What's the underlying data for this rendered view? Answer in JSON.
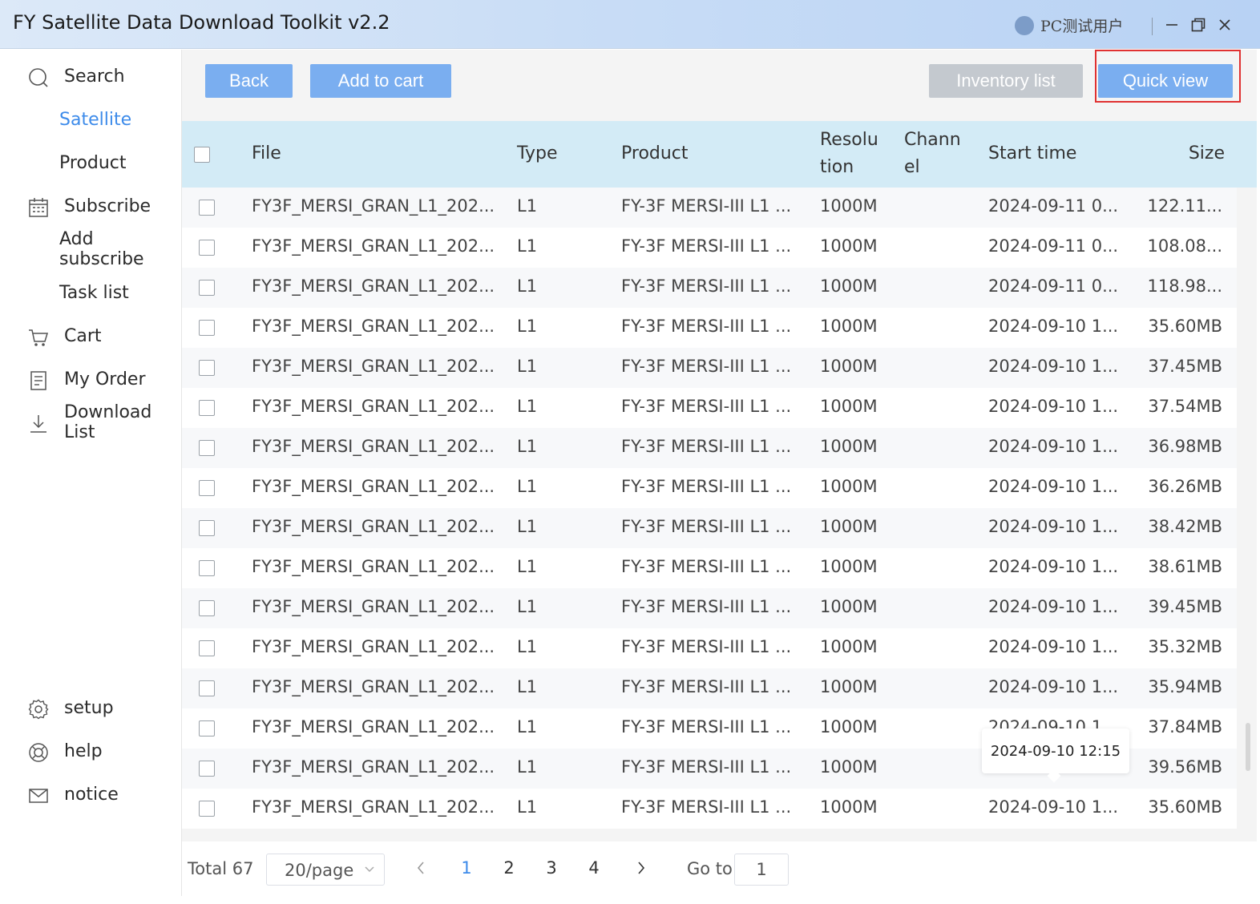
{
  "window": {
    "title": "FY Satellite Data Download Toolkit v2.2",
    "user_name": "PC测试用户"
  },
  "sidebar": {
    "items": [
      {
        "label": "Search",
        "icon": "search-icon"
      },
      {
        "label": "Satellite",
        "icon": ""
      },
      {
        "label": "Product",
        "icon": ""
      },
      {
        "label": "Subscribe",
        "icon": "calendar-icon"
      },
      {
        "label": "Add subscribe",
        "icon": ""
      },
      {
        "label": "Task list",
        "icon": ""
      },
      {
        "label": "Cart",
        "icon": "cart-icon"
      },
      {
        "label": "My Order",
        "icon": "order-icon"
      },
      {
        "label": "Download List",
        "icon": "download-icon"
      }
    ],
    "bottom_items": [
      {
        "label": "setup",
        "icon": "gear-icon"
      },
      {
        "label": "help",
        "icon": "lifebuoy-icon"
      },
      {
        "label": "notice",
        "icon": "mail-icon"
      }
    ],
    "active": "Satellite"
  },
  "toolbar": {
    "back_label": "Back",
    "add_to_cart_label": "Add to cart",
    "inventory_list_label": "Inventory list",
    "quick_view_label": "Quick view"
  },
  "table": {
    "headers": {
      "file": "File",
      "type": "Type",
      "product": "Product",
      "resolution_line1": "Resolu",
      "resolution_line2": "tion",
      "channel_line1": "Chann",
      "channel_line2": "el",
      "start_time": "Start time",
      "size": "Size"
    },
    "rows": [
      {
        "file": "FY3F_MERSI_GRAN_L1_202...",
        "type": "L1",
        "product": "FY-3F MERSI-III L1 ...",
        "resolution": "1000M",
        "channel": "",
        "start": "2024-09-11 0...",
        "size": "122.11..."
      },
      {
        "file": "FY3F_MERSI_GRAN_L1_202...",
        "type": "L1",
        "product": "FY-3F MERSI-III L1 ...",
        "resolution": "1000M",
        "channel": "",
        "start": "2024-09-11 0...",
        "size": "108.08..."
      },
      {
        "file": "FY3F_MERSI_GRAN_L1_202...",
        "type": "L1",
        "product": "FY-3F MERSI-III L1 ...",
        "resolution": "1000M",
        "channel": "",
        "start": "2024-09-11 0...",
        "size": "118.98..."
      },
      {
        "file": "FY3F_MERSI_GRAN_L1_202...",
        "type": "L1",
        "product": "FY-3F MERSI-III L1 ...",
        "resolution": "1000M",
        "channel": "",
        "start": "2024-09-10 1...",
        "size": "35.60MB"
      },
      {
        "file": "FY3F_MERSI_GRAN_L1_202...",
        "type": "L1",
        "product": "FY-3F MERSI-III L1 ...",
        "resolution": "1000M",
        "channel": "",
        "start": "2024-09-10 1...",
        "size": "37.45MB"
      },
      {
        "file": "FY3F_MERSI_GRAN_L1_202...",
        "type": "L1",
        "product": "FY-3F MERSI-III L1 ...",
        "resolution": "1000M",
        "channel": "",
        "start": "2024-09-10 1...",
        "size": "37.54MB"
      },
      {
        "file": "FY3F_MERSI_GRAN_L1_202...",
        "type": "L1",
        "product": "FY-3F MERSI-III L1 ...",
        "resolution": "1000M",
        "channel": "",
        "start": "2024-09-10 1...",
        "size": "36.98MB"
      },
      {
        "file": "FY3F_MERSI_GRAN_L1_202...",
        "type": "L1",
        "product": "FY-3F MERSI-III L1 ...",
        "resolution": "1000M",
        "channel": "",
        "start": "2024-09-10 1...",
        "size": "36.26MB"
      },
      {
        "file": "FY3F_MERSI_GRAN_L1_202...",
        "type": "L1",
        "product": "FY-3F MERSI-III L1 ...",
        "resolution": "1000M",
        "channel": "",
        "start": "2024-09-10 1...",
        "size": "38.42MB"
      },
      {
        "file": "FY3F_MERSI_GRAN_L1_202...",
        "type": "L1",
        "product": "FY-3F MERSI-III L1 ...",
        "resolution": "1000M",
        "channel": "",
        "start": "2024-09-10 1...",
        "size": "38.61MB"
      },
      {
        "file": "FY3F_MERSI_GRAN_L1_202...",
        "type": "L1",
        "product": "FY-3F MERSI-III L1 ...",
        "resolution": "1000M",
        "channel": "",
        "start": "2024-09-10 1...",
        "size": "39.45MB"
      },
      {
        "file": "FY3F_MERSI_GRAN_L1_202...",
        "type": "L1",
        "product": "FY-3F MERSI-III L1 ...",
        "resolution": "1000M",
        "channel": "",
        "start": "2024-09-10 1...",
        "size": "35.32MB"
      },
      {
        "file": "FY3F_MERSI_GRAN_L1_202...",
        "type": "L1",
        "product": "FY-3F MERSI-III L1 ...",
        "resolution": "1000M",
        "channel": "",
        "start": "2024-09-10 1...",
        "size": "35.94MB"
      },
      {
        "file": "FY3F_MERSI_GRAN_L1_202...",
        "type": "L1",
        "product": "FY-3F MERSI-III L1 ...",
        "resolution": "1000M",
        "channel": "",
        "start": "2024-09-10 1",
        "size": "37.84MB"
      },
      {
        "file": "FY3F_MERSI_GRAN_L1_202...",
        "type": "L1",
        "product": "FY-3F MERSI-III L1 ...",
        "resolution": "1000M",
        "channel": "",
        "start": "",
        "size": "39.56MB"
      },
      {
        "file": "FY3F_MERSI_GRAN_L1_202...",
        "type": "L1",
        "product": "FY-3F MERSI-III L1 ...",
        "resolution": "1000M",
        "channel": "",
        "start": "2024-09-10 1...",
        "size": "35.60MB"
      }
    ],
    "tooltip": "2024-09-10 12:15"
  },
  "pagination": {
    "total_label": "Total 67",
    "page_size": "20/page",
    "pages": [
      "1",
      "2",
      "3",
      "4"
    ],
    "current_page": "1",
    "goto_label": "Go to",
    "goto_value": "1"
  },
  "colors": {
    "accent": "#3d8bea",
    "button": "#7aaef0",
    "button_disabled": "#c4c9cf",
    "header_bg": "#d3ebf6",
    "highlight": "#e03131"
  }
}
